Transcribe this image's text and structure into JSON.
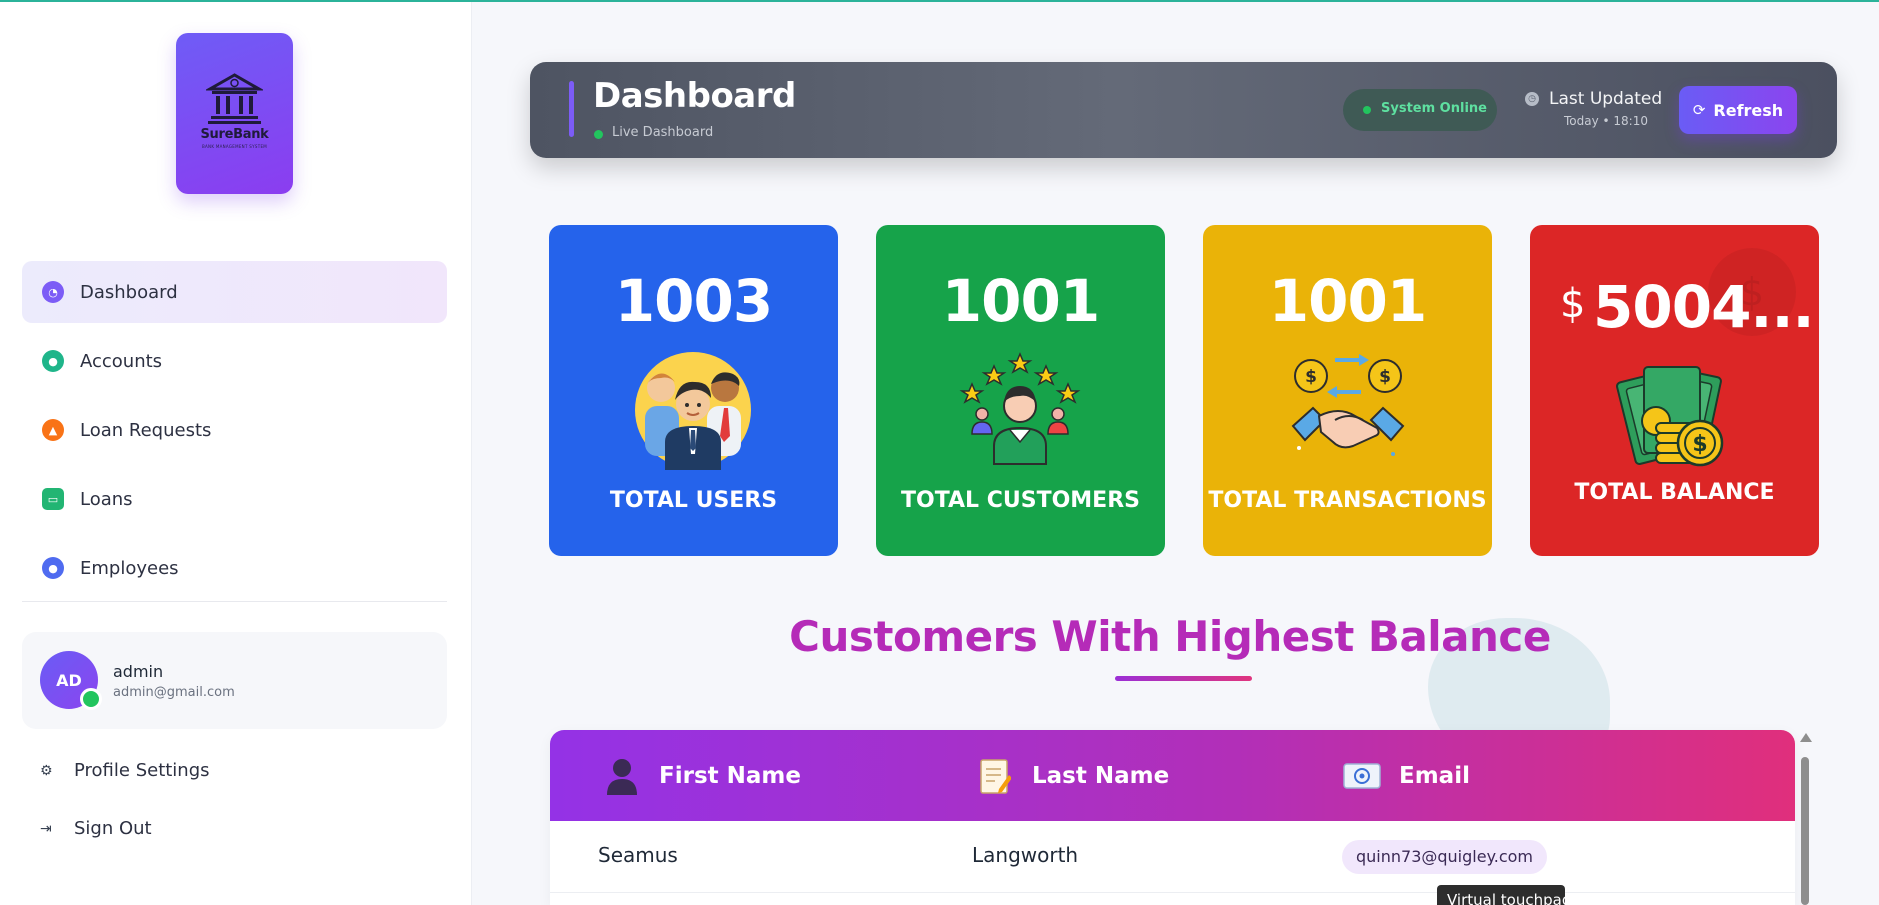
{
  "app": {
    "brand_name": "SureBank",
    "brand_subtitle": "BANK MANAGEMENT SYSTEM"
  },
  "sidebar": {
    "items": [
      {
        "label": "Dashboard",
        "icon": "dashboard-icon",
        "color": "#7c5cf6",
        "active": true
      },
      {
        "label": "Accounts",
        "icon": "accounts-icon",
        "color": "#1fb58a",
        "active": false
      },
      {
        "label": "Loan Requests",
        "icon": "bell-icon",
        "color": "#f97316",
        "active": false
      },
      {
        "label": "Loans",
        "icon": "card-icon",
        "color": "#22b573",
        "active": false
      },
      {
        "label": "Employees",
        "icon": "user-icon",
        "color": "#4f6bf0",
        "active": false
      }
    ],
    "profile": {
      "initials": "AD",
      "name": "admin",
      "email": "admin@gmail.com"
    },
    "profile_settings_label": "Profile Settings",
    "sign_out_label": "Sign Out"
  },
  "header": {
    "title": "Dashboard",
    "live_label": "Live Dashboard",
    "status_label": "System Online",
    "last_updated_label": "Last Updated",
    "last_updated_time": "Today • 18:10",
    "refresh_label": "Refresh"
  },
  "stats": [
    {
      "value": "1003",
      "label": "TOTAL USERS",
      "color": "#2563eb",
      "icon": "users-icon"
    },
    {
      "value": "1001",
      "label": "TOTAL CUSTOMERS",
      "color": "#16a34a",
      "icon": "customers-icon"
    },
    {
      "value": "1001",
      "label": "TOTAL TRANSACTIONS",
      "color": "#eab308",
      "icon": "transactions-icon"
    },
    {
      "value": "5004...",
      "currency": "$",
      "label": "TOTAL BALANCE",
      "color": "#dc2626",
      "icon": "money-icon"
    }
  ],
  "section": {
    "title": "Customers With Highest Balance"
  },
  "table": {
    "columns": [
      {
        "label": "First Name",
        "icon": "person-icon"
      },
      {
        "label": "Last Name",
        "icon": "notepad-icon"
      },
      {
        "label": "Email",
        "icon": "email-icon"
      }
    ],
    "rows": [
      {
        "first_name": "Seamus",
        "last_name": "Langworth",
        "email": "quinn73@quigley.com"
      }
    ]
  },
  "tooltip": {
    "text": "Virtual touchpad"
  }
}
